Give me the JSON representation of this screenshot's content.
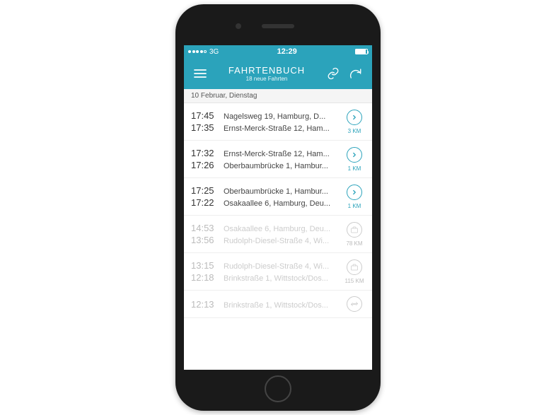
{
  "status": {
    "network": "3G",
    "time": "12:29"
  },
  "header": {
    "title": "FAHRTENBUCH",
    "subtitle": "18 neue Fahrten"
  },
  "date_header": "10 Februar, Dienstag",
  "trips": [
    {
      "faded": false,
      "icon": "chevron",
      "time_a": "17:45",
      "addr_a": "Nagelsweg 19, Hamburg, D...",
      "time_b": "17:35",
      "addr_b": "Ernst-Merck-Straße 12, Ham...",
      "distance": "3 KM"
    },
    {
      "faded": false,
      "icon": "chevron",
      "time_a": "17:32",
      "addr_a": "Ernst-Merck-Straße 12, Ham...",
      "time_b": "17:26",
      "addr_b": "Oberbaumbrücke 1, Hambur...",
      "distance": "1 KM"
    },
    {
      "faded": false,
      "icon": "chevron",
      "time_a": "17:25",
      "addr_a": "Oberbaumbrücke 1, Hambur...",
      "time_b": "17:22",
      "addr_b": "Osakaallee 6, Hamburg, Deu...",
      "distance": "1 KM"
    },
    {
      "faded": true,
      "icon": "briefcase",
      "time_a": "14:53",
      "addr_a": "Osakaallee 6, Hamburg, Deu...",
      "time_b": "13:56",
      "addr_b": "Rudolph-Diesel-Straße 4, Wi...",
      "distance": "78 KM"
    },
    {
      "faded": true,
      "icon": "briefcase",
      "time_a": "13:15",
      "addr_a": "Rudolph-Diesel-Straße 4, Wi...",
      "time_b": "12:18",
      "addr_b": "Brinkstraße 1, Wittstock/Dos...",
      "distance": "115 KM"
    },
    {
      "faded": true,
      "icon": "swap",
      "time_a": "12:13",
      "addr_a": "Brinkstraße 1, Wittstock/Dos...",
      "time_b": "",
      "addr_b": "",
      "distance": ""
    }
  ]
}
